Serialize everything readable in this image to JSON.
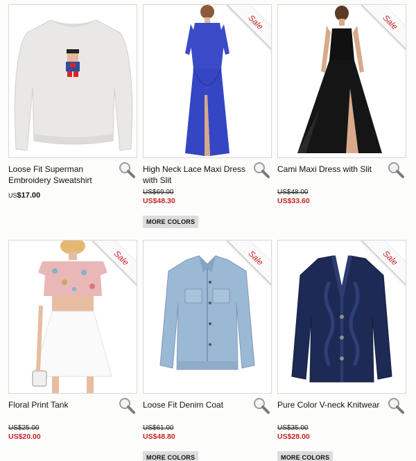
{
  "products": [
    {
      "name": "Loose Fit Superman Embroidery Sweatshirt",
      "price_currency": "US",
      "price_amount": "$17.00",
      "sale": false,
      "image": "white-sweatshirt"
    },
    {
      "name": "High Neck Lace Maxi Dress with Slit",
      "old_price": "US$69.00",
      "new_price": "US$48.30",
      "sale": true,
      "sale_label": "Sale",
      "more_colors": "MORE COLORS",
      "image": "blue-lace-dress"
    },
    {
      "name": "Cami Maxi Dress with Slit",
      "old_price": "US$48.00",
      "new_price": "US$33.60",
      "sale": true,
      "sale_label": "Sale",
      "image": "black-maxi-dress"
    },
    {
      "name": "Floral Print Tank",
      "old_price": "US$25.00",
      "new_price": "US$20.00",
      "sale": true,
      "sale_label": "Sale",
      "image": "floral-crop-top-white-skirt"
    },
    {
      "name": "Loose Fit Denim Coat",
      "old_price": "US$61.00",
      "new_price": "US$48.80",
      "sale": true,
      "sale_label": "Sale",
      "more_colors": "MORE COLORS",
      "image": "denim-jacket"
    },
    {
      "name": "Pure Color V-neck Knitwear",
      "old_price": "US$35.00",
      "new_price": "US$28.00",
      "sale": true,
      "sale_label": "Sale",
      "more_colors": "MORE COLORS",
      "image": "navy-cardigan"
    }
  ],
  "icons": {
    "zoom": "magnifier-icon"
  },
  "colors": {
    "sale_red": "#c8232a",
    "button_gray": "#dcdcdc",
    "border": "#d8d8d8"
  }
}
